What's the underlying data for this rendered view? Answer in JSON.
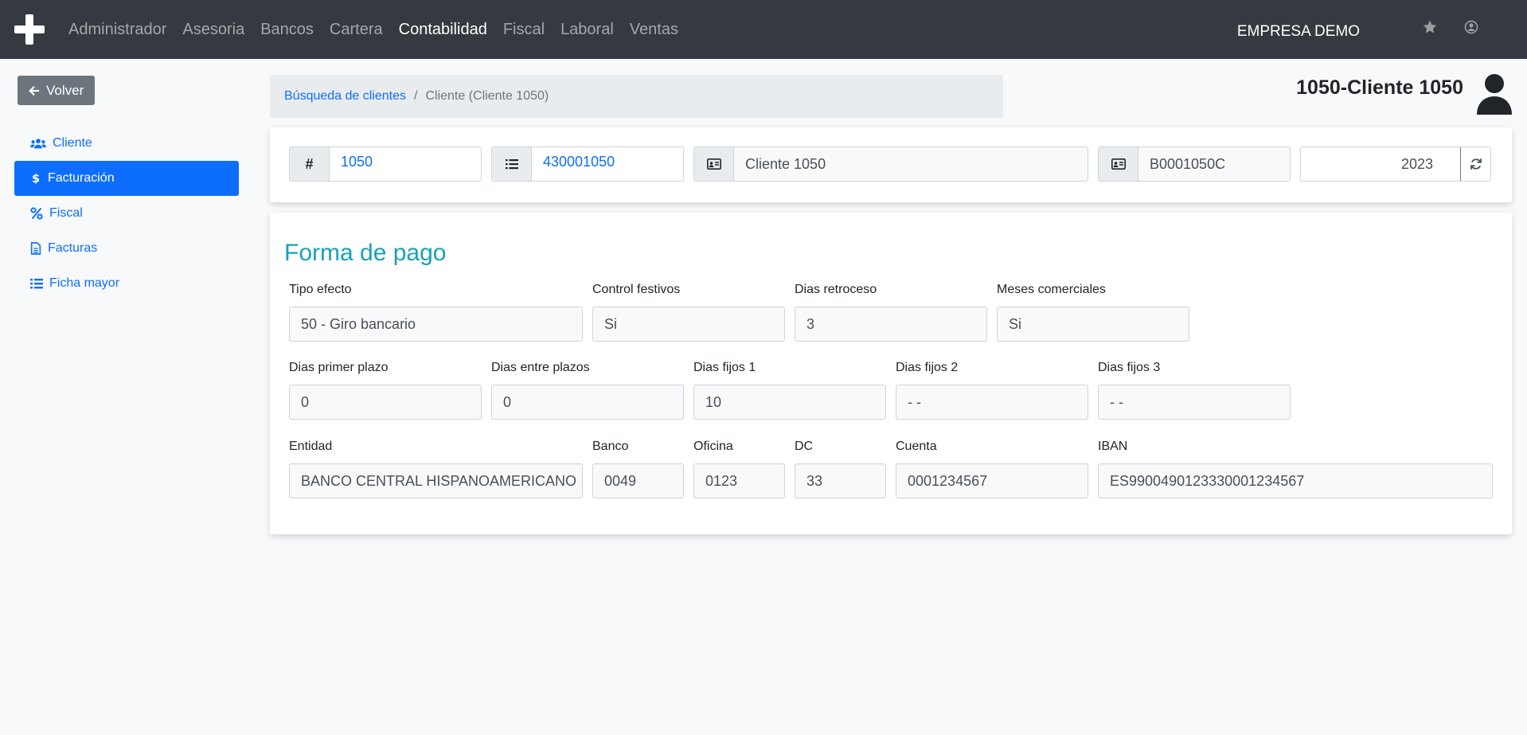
{
  "nav": {
    "items": [
      {
        "label": "Administrador",
        "active": false
      },
      {
        "label": "Asesoria",
        "active": false
      },
      {
        "label": "Bancos",
        "active": false
      },
      {
        "label": "Cartera",
        "active": false
      },
      {
        "label": "Contabilidad",
        "active": true
      },
      {
        "label": "Fiscal",
        "active": false
      },
      {
        "label": "Laboral",
        "active": false
      },
      {
        "label": "Ventas",
        "active": false
      }
    ],
    "company": "EMPRESA DEMO",
    "icons": [
      "plus-icon",
      "star-icon",
      "user-circle-icon"
    ]
  },
  "sidebar": {
    "back_label": "Volver",
    "items": [
      {
        "label": "Cliente",
        "icon": "users-icon",
        "active": false
      },
      {
        "label": "Facturación",
        "icon": "dollar-icon",
        "active": true
      },
      {
        "label": "Fiscal",
        "icon": "percent-icon",
        "active": false
      },
      {
        "label": "Facturas",
        "icon": "file-icon",
        "active": false
      },
      {
        "label": "Ficha mayor",
        "icon": "list-icon",
        "active": false
      }
    ]
  },
  "breadcrumb": {
    "link": "Búsqueda de clientes",
    "separator": "/",
    "current": "Cliente (Cliente 1050)"
  },
  "header": {
    "client_title": "1050-Cliente 1050"
  },
  "top_fields": {
    "code_addon": "#",
    "code": "1050",
    "account": "430001050",
    "name": "Cliente 1050",
    "nif": "B0001050C",
    "year": "2023"
  },
  "payment": {
    "title": "Forma de pago",
    "tipo_efecto_label": "Tipo efecto",
    "tipo_efecto": "50 - Giro bancario",
    "control_festivos_label": "Control festivos",
    "control_festivos": "Si",
    "dias_retroceso_label": "Dias retroceso",
    "dias_retroceso": "3",
    "meses_comerciales_label": "Meses comerciales",
    "meses_comerciales": "Si",
    "dias_primer_plazo_label": "Dias primer plazo",
    "dias_primer_plazo": "0",
    "dias_entre_plazos_label": "Dias entre plazos",
    "dias_entre_plazos": "0",
    "dias_fijos_1_label": "Dias fijos 1",
    "dias_fijos_1": "10",
    "dias_fijos_2_label": "Dias fijos 2",
    "dias_fijos_2": "- -",
    "dias_fijos_3_label": "Dias fijos 3",
    "dias_fijos_3": "- -",
    "entidad_label": "Entidad",
    "entidad": "BANCO CENTRAL HISPANOAMERICANO",
    "banco_label": "Banco",
    "banco": "0049",
    "oficina_label": "Oficina",
    "oficina": "0123",
    "dc_label": "DC",
    "dc": "33",
    "cuenta_label": "Cuenta",
    "cuenta": "0001234567",
    "iban_label": "IBAN",
    "iban": "ES9900490123330001234567"
  }
}
